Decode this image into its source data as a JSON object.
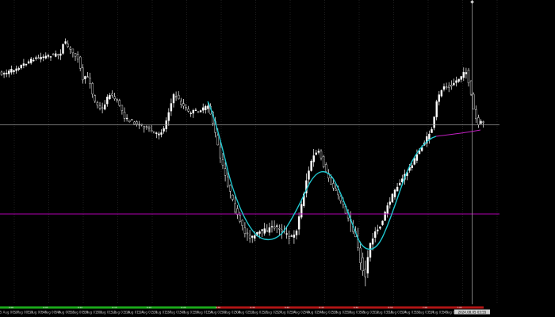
{
  "colors": {
    "background": "#000000",
    "candle": "#ffffff",
    "grid": "#3c3c3c",
    "crosshair": "#9a9a9a",
    "horizontal_line": "#b000b0",
    "fit_curve": "#1fc6cf",
    "fit_extension": "#c020c0",
    "session_green": "#1aa81a",
    "session_red": "#b01515"
  },
  "icons": {
    "cursor_marker": "crosshair-icon"
  },
  "time_axis": {
    "labels": [
      "5 Aug 00:27",
      "5 Aug 00:33",
      "5 Aug 00:40",
      "5 Aug 00:46",
      "5 Aug 00:53",
      "5 Aug 00:59",
      "5 Aug 01:05",
      "5 Aug 01:12",
      "5 Aug 01:18",
      "5 Aug 01:24",
      "5 Aug 01:31",
      "5 Aug 01:37",
      "5 Aug 01:43",
      "5 Aug 01:50",
      "5 Aug 01:56",
      "5 Aug 02:02",
      "5 Aug 02:08",
      "5 Aug 02:15",
      "5 Aug 02:21",
      "5 Aug 02:27",
      "5 Aug 02:34",
      "5 Aug 02:40",
      "5 Aug 02:46",
      "5 Aug 02:53",
      "5 Aug 02:59",
      "5 Aug 03:05",
      "5 Aug 03:12",
      "5 Aug 03:18",
      "5 Aug 03:24",
      "5 Aug 03:31",
      "5 Aug 03:37",
      "5 Aug 03:43",
      "5 Aug 03:48",
      "5 Aug 03:55",
      "5 Aug 04:01",
      "5 Aug 04:08"
    ],
    "cursor_time": "2024.08.05 03:55",
    "session_labels": [
      "0:00",
      "6:05",
      "6:10",
      "6:15",
      "6:20",
      "6:25",
      "6:30",
      "6:35",
      "6:40",
      "6:45",
      "6:50",
      "6:55",
      "7:00",
      "7:05"
    ]
  },
  "price_scale": {
    "current_price": "",
    "line_price": ""
  }
}
